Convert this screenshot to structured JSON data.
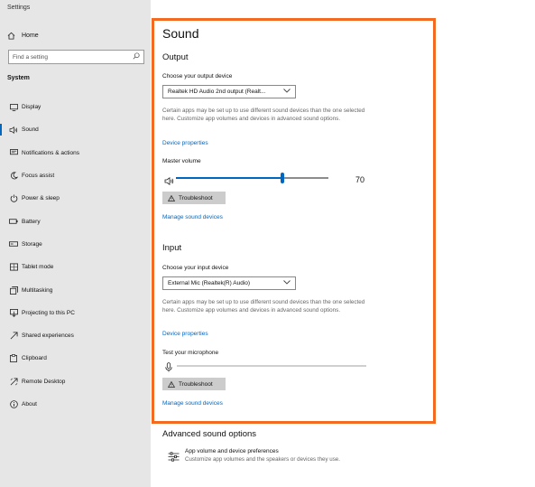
{
  "app": {
    "title": "Settings"
  },
  "sidebar": {
    "home_label": "Home",
    "search_placeholder": "Find a setting",
    "section_label": "System",
    "items": [
      {
        "label": "Display",
        "icon": "display-icon",
        "active": false
      },
      {
        "label": "Sound",
        "icon": "speaker-icon",
        "active": true
      },
      {
        "label": "Notifications & actions",
        "icon": "notifications-icon",
        "active": false
      },
      {
        "label": "Focus assist",
        "icon": "moon-icon",
        "active": false
      },
      {
        "label": "Power & sleep",
        "icon": "power-icon",
        "active": false
      },
      {
        "label": "Battery",
        "icon": "battery-icon",
        "active": false
      },
      {
        "label": "Storage",
        "icon": "storage-icon",
        "active": false
      },
      {
        "label": "Tablet mode",
        "icon": "tablet-icon",
        "active": false
      },
      {
        "label": "Multitasking",
        "icon": "multitasking-icon",
        "active": false
      },
      {
        "label": "Projecting to this PC",
        "icon": "projecting-icon",
        "active": false
      },
      {
        "label": "Shared experiences",
        "icon": "shared-experiences-icon",
        "active": false
      },
      {
        "label": "Clipboard",
        "icon": "clipboard-icon",
        "active": false
      },
      {
        "label": "Remote Desktop",
        "icon": "remote-desktop-icon",
        "active": false
      },
      {
        "label": "About",
        "icon": "info-icon",
        "active": false
      }
    ]
  },
  "main": {
    "title": "Sound",
    "output": {
      "heading": "Output",
      "device_label": "Choose your output device",
      "device_value": "Realtek HD Audio 2nd output (Realt...",
      "description": "Certain apps may be set up to use different sound devices than the one selected here. Customize app volumes and devices in advanced sound options.",
      "properties_link": "Device properties",
      "volume_label": "Master volume",
      "volume_value": "70",
      "volume_fraction": 0.7,
      "troubleshoot_label": "Troubleshoot",
      "manage_link": "Manage sound devices"
    },
    "input": {
      "heading": "Input",
      "device_label": "Choose your input device",
      "device_value": "External Mic (Realtek(R) Audio)",
      "description": "Certain apps may be set up to use different sound devices than the one selected here. Customize app volumes and devices in advanced sound options.",
      "properties_link": "Device properties",
      "mic_label": "Test your microphone",
      "mic_level": 0,
      "troubleshoot_label": "Troubleshoot",
      "manage_link": "Manage sound devices"
    },
    "advanced": {
      "heading": "Advanced sound options",
      "item_title": "App volume and device preferences",
      "item_desc": "Customize app volumes and the speakers or devices they use."
    }
  },
  "colors": {
    "accent": "#0067c0",
    "highlight": "#f26b21",
    "sidebar_bg": "#e6e6e6"
  }
}
